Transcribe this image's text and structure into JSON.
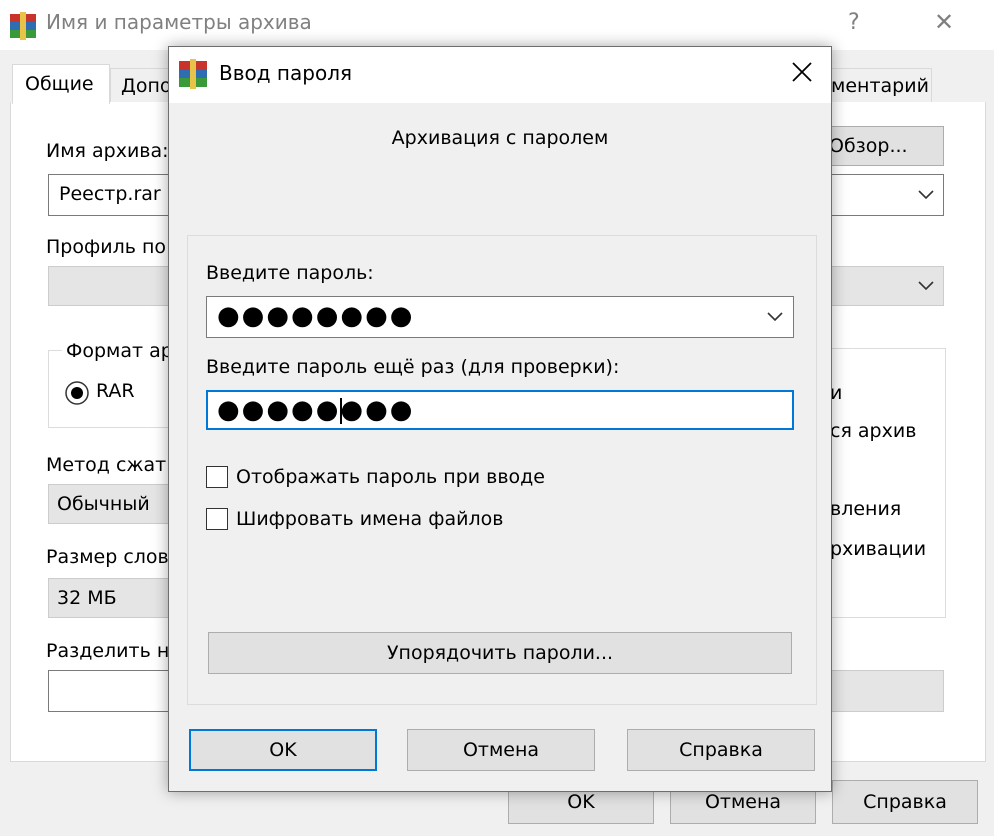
{
  "background_window": {
    "title": "Имя и параметры архива",
    "help_glyph": "?",
    "close_glyph": "✕",
    "tabs": [
      "Общие",
      "Допо",
      "ментарий"
    ],
    "archive_name_label": "Имя архива:",
    "archive_name_value": "Реестр.rar",
    "browse_button": "Обзор...",
    "profile_label": "Профиль по",
    "format_label": "Формат ар",
    "format_option": "RAR",
    "method_label": "Метод сжат",
    "method_value": "Обычный",
    "dict_label": "Размер слов",
    "dict_value": "32 МБ",
    "split_label": "Разделить н",
    "right_options": [
      "и",
      "ся архив",
      "вления",
      "рхивации"
    ],
    "ok_button": "OK",
    "cancel_button": "Отмена",
    "help_button": "Справка"
  },
  "dialog": {
    "title": "Ввод пароля",
    "heading": "Архивация с паролем",
    "password_label": "Введите пароль:",
    "password_value": "●●●●●●●●",
    "confirm_label": "Введите пароль ещё раз (для проверки):",
    "confirm_value": "●●●●●●●●",
    "show_password_label": "Отображать пароль при вводе",
    "show_password_checked": false,
    "encrypt_names_label": "Шифровать имена файлов",
    "encrypt_names_checked": false,
    "organize_button": "Упорядочить пароли...",
    "ok_button": "OK",
    "cancel_button": "Отмена",
    "help_button": "Справка"
  },
  "colors": {
    "focus_border": "#0078d7",
    "window_bg": "#f0f0f0"
  }
}
